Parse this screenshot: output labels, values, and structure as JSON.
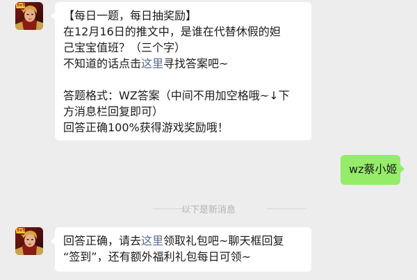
{
  "messages": [
    {
      "side": "left",
      "lines": [
        "【每日一题，每日抽奖励】",
        "在12月16日的推文中，是谁在代替休假的妲",
        "己宝宝值班？（三个字）"
      ],
      "line4_prefix": "不知道的话点击",
      "line4_link": "这里",
      "line4_suffix": "寻找答案吧~",
      "lines_after": [
        "答题格式：WZ答案（中间不用加空格哦~↓下",
        "方消息栏回复即可）",
        "回答正确100%获得游戏奖励哦！"
      ]
    },
    {
      "side": "right",
      "text": "wz蔡小姬"
    },
    {
      "side": "left",
      "line1_prefix": "回答正确，请去",
      "line1_link": "这里",
      "line1_suffix": "领取礼包吧~聊天框回复",
      "line2": "“签到”，还有额外福利礼包每日可领~"
    }
  ],
  "divider_text": "以下是新消息",
  "avatar": {
    "badge_text": "5v5",
    "icon": "king-of-glory-hero-avatar-icon"
  },
  "colors": {
    "background": "#ededed",
    "bubble_incoming": "#ffffff",
    "bubble_outgoing": "#95ec69",
    "link": "#576b95",
    "divider_text": "#b2b2b2"
  }
}
